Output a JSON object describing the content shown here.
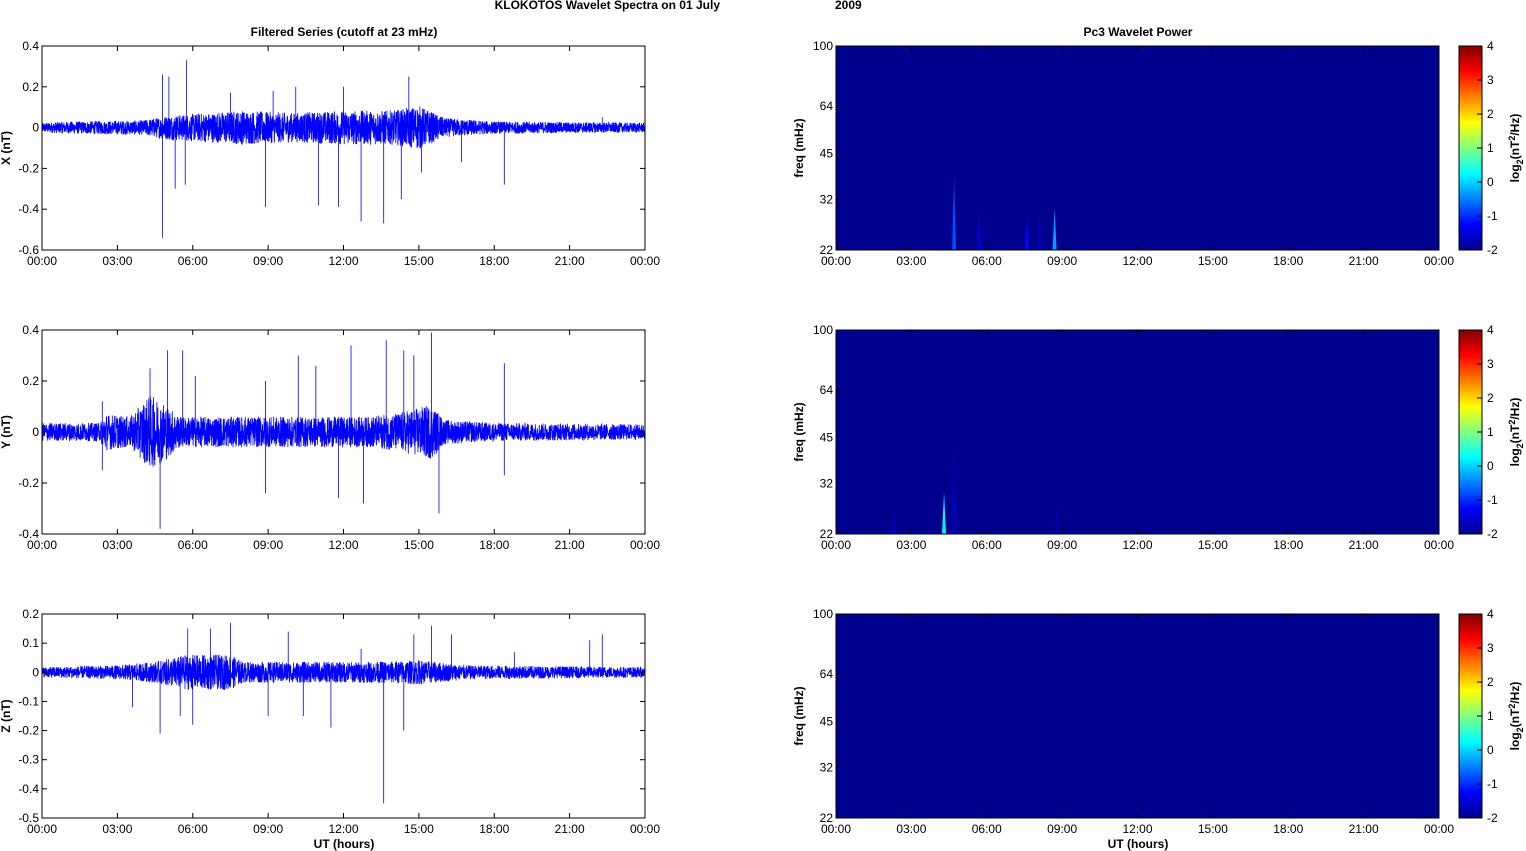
{
  "chart_data": {
    "title_left": "KLOKOTOS Wavelet Spectra on 01 July",
    "title_year": "2009",
    "left_title": "Filtered Series (cutoff at 23 mHz)",
    "right_title": "Pc3 Wavelet Power",
    "xlabel": "UT (hours)",
    "x_ticks": [
      "00:00",
      "03:00",
      "06:00",
      "09:00",
      "12:00",
      "15:00",
      "18:00",
      "21:00",
      "00:00"
    ],
    "xlim": [
      0,
      24
    ],
    "freq_label": "freq (mHz)",
    "freq_ticks": [
      100,
      64,
      45,
      32,
      22
    ],
    "colorbar_label": "log2(nT^2/Hz)",
    "colorbar_ticks": [
      4,
      3,
      2,
      1,
      0,
      -1,
      -2
    ],
    "colorbar_range": [
      -2,
      4
    ],
    "series": [
      {
        "type": "line",
        "name": "X",
        "ylabel": "X (nT)",
        "ylim": [
          -0.6,
          0.4
        ],
        "yticks": [
          "0.4",
          "0.2",
          "0",
          "-0.2",
          "-0.4",
          "-0.6"
        ],
        "yvals": [
          0.4,
          0.2,
          0,
          -0.2,
          -0.4,
          -0.6
        ],
        "envelope": [
          [
            0,
            0.02
          ],
          [
            1,
            0.025
          ],
          [
            4,
            0.03
          ],
          [
            5,
            0.05
          ],
          [
            8,
            0.07
          ],
          [
            10,
            0.06
          ],
          [
            12,
            0.07
          ],
          [
            14,
            0.07
          ],
          [
            15,
            0.09
          ],
          [
            16,
            0.04
          ],
          [
            18,
            0.025
          ],
          [
            24,
            0.02
          ]
        ],
        "spikes": [
          [
            4.8,
            -0.54
          ],
          [
            4.8,
            0.26
          ],
          [
            5.05,
            0.25
          ],
          [
            5.3,
            -0.3
          ],
          [
            5.75,
            0.33
          ],
          [
            5.7,
            -0.28
          ],
          [
            7.5,
            0.17
          ],
          [
            8.9,
            -0.39
          ],
          [
            9.2,
            0.18
          ],
          [
            10.1,
            0.2
          ],
          [
            11.0,
            -0.38
          ],
          [
            11.8,
            -0.39
          ],
          [
            12.0,
            0.2
          ],
          [
            12.7,
            -0.46
          ],
          [
            13.6,
            -0.47
          ],
          [
            14.3,
            -0.35
          ],
          [
            14.6,
            0.25
          ],
          [
            15.1,
            -0.22
          ],
          [
            16.7,
            -0.17
          ],
          [
            18.4,
            -0.28
          ],
          [
            22.3,
            0.05
          ]
        ]
      },
      {
        "type": "line",
        "name": "Y",
        "ylabel": "Y (nT)",
        "ylim": [
          -0.4,
          0.4
        ],
        "yticks": [
          "0.4",
          "0.2",
          "0",
          "-0.2",
          "-0.4"
        ],
        "yvals": [
          0.4,
          0.2,
          0,
          -0.2,
          -0.4
        ],
        "envelope": [
          [
            0,
            0.03
          ],
          [
            2.3,
            0.03
          ],
          [
            2.5,
            0.06
          ],
          [
            3.5,
            0.05
          ],
          [
            4.3,
            0.12
          ],
          [
            4.8,
            0.1
          ],
          [
            5.5,
            0.05
          ],
          [
            9,
            0.05
          ],
          [
            13,
            0.05
          ],
          [
            14,
            0.06
          ],
          [
            15.5,
            0.09
          ],
          [
            16,
            0.04
          ],
          [
            18,
            0.03
          ],
          [
            24,
            0.025
          ]
        ],
        "spikes": [
          [
            2.4,
            0.12
          ],
          [
            2.4,
            -0.15
          ],
          [
            4.3,
            0.25
          ],
          [
            4.7,
            -0.38
          ],
          [
            5.0,
            0.32
          ],
          [
            5.6,
            0.32
          ],
          [
            6.1,
            0.22
          ],
          [
            8.9,
            0.2
          ],
          [
            8.9,
            -0.24
          ],
          [
            10.2,
            0.3
          ],
          [
            10.9,
            0.26
          ],
          [
            11.8,
            -0.26
          ],
          [
            12.3,
            0.34
          ],
          [
            12.8,
            -0.28
          ],
          [
            13.7,
            0.36
          ],
          [
            14.4,
            0.32
          ],
          [
            14.8,
            0.3
          ],
          [
            15.5,
            0.39
          ],
          [
            15.8,
            -0.32
          ],
          [
            18.4,
            0.27
          ],
          [
            18.4,
            -0.17
          ]
        ]
      },
      {
        "type": "line",
        "name": "Z",
        "ylabel": "Z (nT)",
        "ylim": [
          -0.5,
          0.2
        ],
        "yticks": [
          "0.2",
          "0.1",
          "0",
          "-0.1",
          "-0.2",
          "-0.3",
          "-0.4",
          "-0.5"
        ],
        "yvals": [
          0.2,
          0.1,
          0,
          -0.1,
          -0.2,
          -0.3,
          -0.4,
          -0.5
        ],
        "envelope": [
          [
            0,
            0.015
          ],
          [
            3,
            0.02
          ],
          [
            4.5,
            0.03
          ],
          [
            5.7,
            0.05
          ],
          [
            7.5,
            0.05
          ],
          [
            8,
            0.03
          ],
          [
            13,
            0.03
          ],
          [
            15,
            0.035
          ],
          [
            17,
            0.02
          ],
          [
            24,
            0.015
          ]
        ],
        "spikes": [
          [
            3.6,
            -0.12
          ],
          [
            4.7,
            -0.21
          ],
          [
            5.5,
            -0.15
          ],
          [
            5.8,
            0.15
          ],
          [
            6.0,
            -0.18
          ],
          [
            6.7,
            0.15
          ],
          [
            7.5,
            0.17
          ],
          [
            9.0,
            -0.15
          ],
          [
            9.8,
            0.14
          ],
          [
            10.4,
            -0.15
          ],
          [
            11.5,
            -0.19
          ],
          [
            12.7,
            0.08
          ],
          [
            13.6,
            -0.45
          ],
          [
            14.4,
            -0.2
          ],
          [
            14.8,
            0.13
          ],
          [
            15.5,
            0.16
          ],
          [
            16.3,
            0.13
          ],
          [
            18.8,
            0.07
          ],
          [
            21.8,
            0.11
          ],
          [
            22.3,
            0.13
          ]
        ]
      }
    ],
    "wavelet_hotspots": [
      [
        {
          "t": 4.7,
          "f": 22,
          "top": 38,
          "power": -0.8
        },
        {
          "t": 5.7,
          "f": 22,
          "top": 30,
          "power": -1.5
        },
        {
          "t": 7.6,
          "f": 22,
          "top": 28,
          "power": -1.2
        },
        {
          "t": 8.1,
          "f": 22,
          "top": 29,
          "power": -1.6
        },
        {
          "t": 8.7,
          "f": 22,
          "top": 30,
          "power": -0.3
        }
      ],
      [
        {
          "t": 2.3,
          "f": 22,
          "top": 26,
          "power": -1.6
        },
        {
          "t": 4.3,
          "f": 22,
          "top": 30,
          "power": 0.2
        },
        {
          "t": 4.7,
          "f": 22,
          "top": 45,
          "power": -1.6
        },
        {
          "t": 8.8,
          "f": 22,
          "top": 28,
          "power": -1.7
        }
      ],
      []
    ]
  }
}
